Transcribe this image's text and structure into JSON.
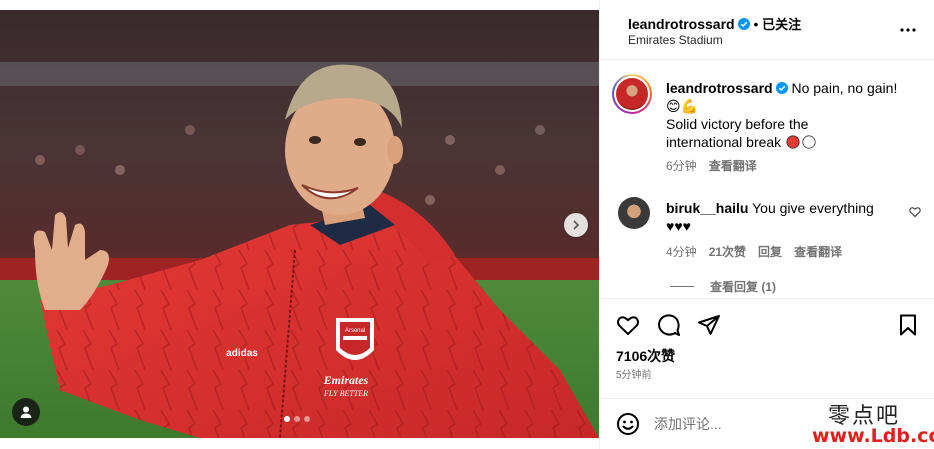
{
  "post": {
    "media": {
      "jacket_text": "Emirates",
      "jacket_sub": "FLY BETTER",
      "crest_text": "Arsenal",
      "brand": "adidas",
      "carousel": {
        "count": 3,
        "active": 1
      },
      "next_icon": "chevron-right-icon",
      "tag_icon": "user-tag-icon"
    },
    "header": {
      "username": "leandrotrossard",
      "separator": "•",
      "follow_label": "已关注",
      "location": "Emirates Stadium",
      "more_icon": "more-horizontal-icon"
    },
    "caption": {
      "username": "leandrotrossard",
      "text_line1": "No pain, no gain!",
      "emojis": "😊💪",
      "text_line2": "Solid victory before the",
      "text_line3": "international break",
      "time": "6分钟",
      "translate": "查看翻译"
    },
    "comment": {
      "username": "biruk__hailu",
      "text": "You give everything",
      "hearts": "♥♥♥",
      "time": "4分钟",
      "likes": "21次赞",
      "reply": "回复",
      "translate": "查看翻译",
      "view_replies": "查看回复 (1)"
    },
    "actions": {
      "likes": "7106次赞",
      "time_ago": "5分钟前"
    },
    "comment_bar": {
      "placeholder": "添加评论..."
    },
    "colors": {
      "verified": "#0095f6",
      "jacket_red": "#d32f2f",
      "muted": "#737373"
    }
  },
  "watermark": {
    "line1": "零点吧",
    "line2": "www.Ldb.cc"
  }
}
